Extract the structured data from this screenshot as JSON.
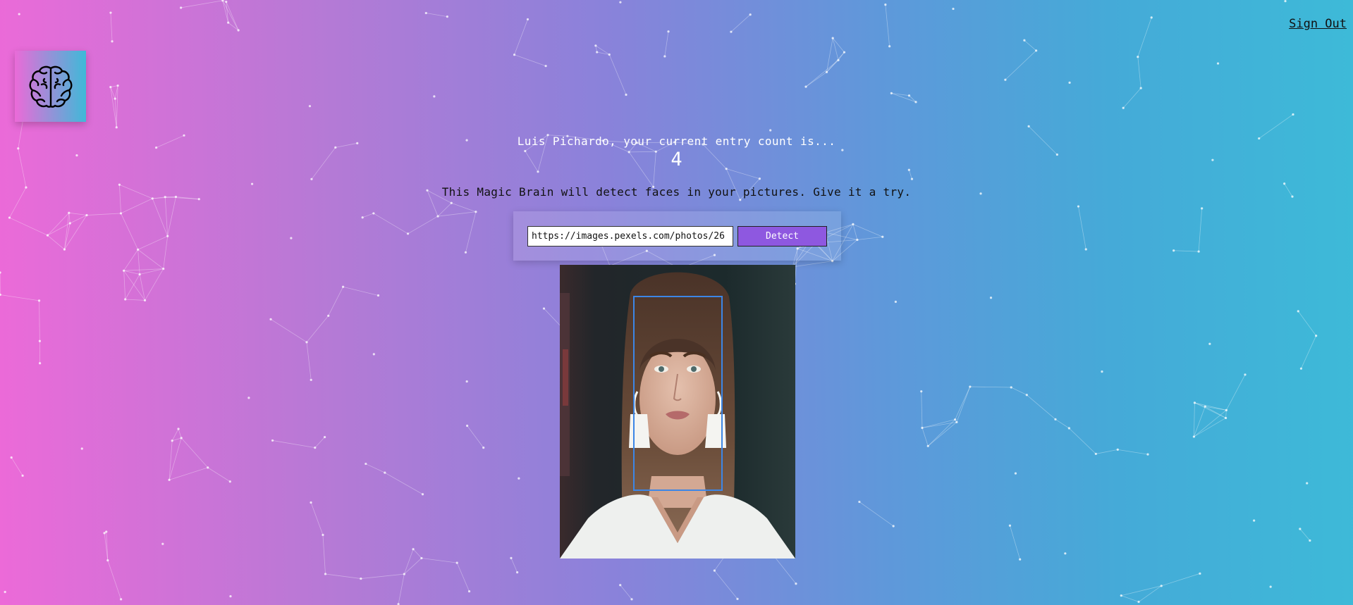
{
  "nav": {
    "sign_out_label": "Sign Out"
  },
  "logo": {
    "icon": "brain-icon"
  },
  "rank": {
    "greeting": "Luis Pichardo, your current entry count is...",
    "entries": "4"
  },
  "form": {
    "description": "This Magic Brain will detect faces in your pictures. Give it a try.",
    "url_value": "https://images.pexels.com/photos/26",
    "detect_label": "Detect"
  },
  "result": {
    "face_boxes": 1
  },
  "colors": {
    "gradient_start": "#ec6ad8",
    "gradient_end": "#3dbad8",
    "button": "#8e58e0",
    "face_box": "#3c86e6"
  }
}
